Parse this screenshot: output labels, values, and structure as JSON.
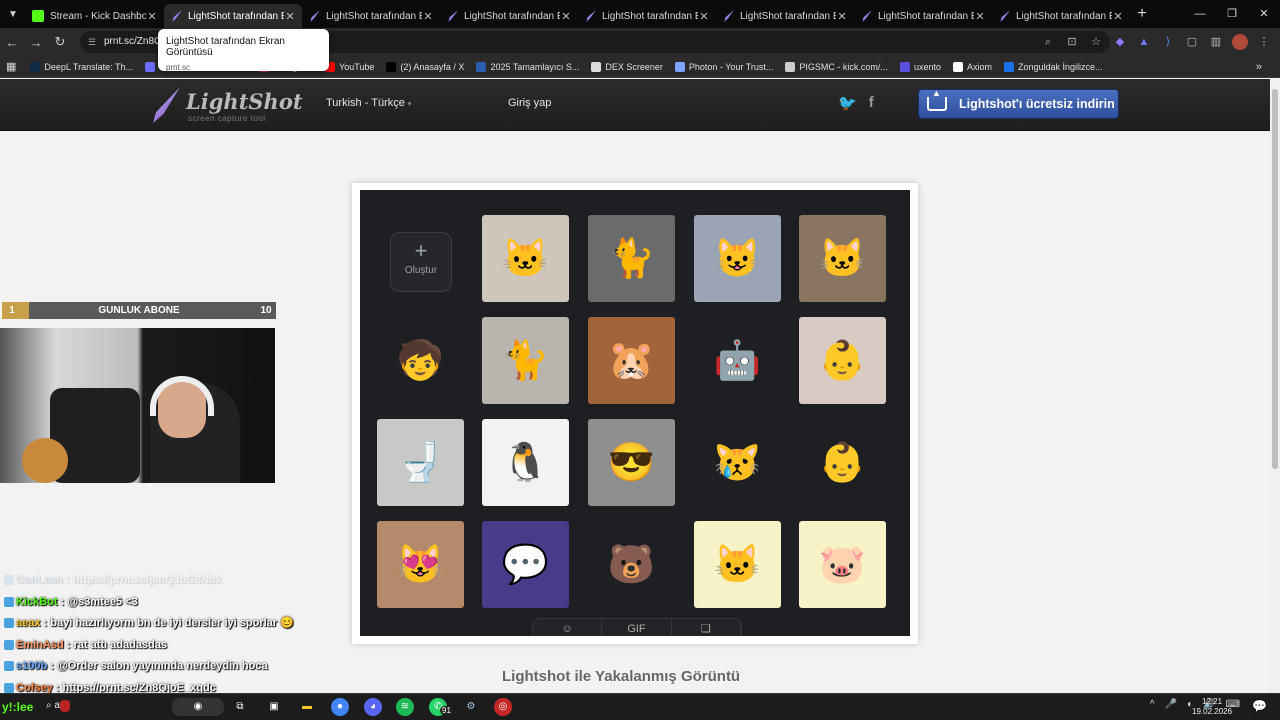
{
  "browser": {
    "tabs": [
      {
        "label": "Stream - Kick Dashboard",
        "icon": "kick-icon",
        "active": false
      },
      {
        "label": "LightShot tarafından Ekra",
        "icon": "lightshot-icon",
        "active": true
      },
      {
        "label": "LightShot tarafından Ekra",
        "icon": "lightshot-icon",
        "active": false
      },
      {
        "label": "LightShot tarafından Ekra",
        "icon": "lightshot-icon",
        "active": false
      },
      {
        "label": "LightShot tarafından Ekra",
        "icon": "lightshot-icon",
        "active": false
      },
      {
        "label": "LightShot tarafından Ekra",
        "icon": "lightshot-icon",
        "active": false
      },
      {
        "label": "LightShot tarafından Ekra",
        "icon": "lightshot-icon",
        "active": false
      },
      {
        "label": "LightShot tarafından Ekra",
        "icon": "lightshot-icon",
        "active": false
      }
    ],
    "tooltip": {
      "title": "LightShot tarafından Ekran Görüntüsü",
      "host": "prnt.sc"
    },
    "url": "prnt.sc/Zn8Q",
    "bookmarks": [
      {
        "label": "DeepL Translate: Th...",
        "color": "#0f2b46"
      },
      {
        "label": "rahmican - Kick Stat...",
        "color": "#6d6dff"
      },
      {
        "label": "Instagram",
        "color": "#e1306c"
      },
      {
        "label": "YouTube",
        "color": "#ff0000"
      },
      {
        "label": "(2) Anasayfa / X",
        "color": "#000000"
      },
      {
        "label": "2025 Tamamlayıcı S...",
        "color": "#2a5db0"
      },
      {
        "label": "DEX Screener",
        "color": "#dddddd"
      },
      {
        "label": "Photon - Your Trust...",
        "color": "#7fa7ff"
      },
      {
        "label": "PIGSMC - kick.com/...",
        "color": "#cccccc"
      },
      {
        "label": "uxento",
        "color": "#5b4fe0"
      },
      {
        "label": "Axiom",
        "color": "#ffffff"
      },
      {
        "label": "Zonguldak İngilizce...",
        "color": "#1a73e8"
      }
    ]
  },
  "lightshot": {
    "logo_name": "LightShot",
    "logo_tagline": "screen capture tool",
    "language": "Turkish - Türkçe",
    "login": "Giriş yap",
    "download_label": "Lightshot'ı ücretsiz indirin",
    "caption": "Lightshot ile Yakalanmış Görüntü",
    "create_label": "Oluştur",
    "bottom_tabs": [
      "☺",
      "GIF",
      "❏"
    ]
  },
  "stickers": [
    {
      "icon": "🐱",
      "bg": "#cfc6bb"
    },
    {
      "icon": "🐈",
      "bg": "#6b6b6b"
    },
    {
      "icon": "😺",
      "bg": "#9aa4b5"
    },
    {
      "icon": "🐱",
      "bg": "#8a7660"
    },
    {
      "icon": "🧒",
      "bg": "#1e1f22"
    },
    {
      "icon": "🐈",
      "bg": "#b9b4ad"
    },
    {
      "icon": "🐹",
      "bg": "#a2653b"
    },
    {
      "icon": "🤖",
      "bg": "#1e1f22"
    },
    {
      "icon": "👶",
      "bg": "#d9cbc4"
    },
    {
      "icon": "🚽",
      "bg": "#c7c9c7"
    },
    {
      "icon": "🐧",
      "bg": "#f2f2f2"
    },
    {
      "icon": "😎",
      "bg": "#8f8f8f"
    },
    {
      "icon": "😿",
      "bg": "#1e1f22"
    },
    {
      "icon": "👶",
      "bg": "#1e1f22"
    },
    {
      "icon": "😻",
      "bg": "#b58a6a"
    },
    {
      "icon": "💬",
      "bg": "#4a3a8a"
    },
    {
      "icon": "🐻",
      "bg": "#1e1f22"
    },
    {
      "icon": "🐱",
      "bg": "#f7f3c6"
    },
    {
      "icon": "🐷",
      "bg": "#f7f3c6"
    }
  ],
  "stream": {
    "sub_goal": {
      "left": "1",
      "label": "GUNLUK ABONE",
      "right": "10",
      "progress": 0.1
    },
    "chat": [
      {
        "user": "ConLean",
        "text": "https://prnt.sc/jsnQ3bG8Nbk",
        "color": "#9ad0ff",
        "faded": true
      },
      {
        "user": "KickBot",
        "text": "@s3mtee5 <3",
        "color": "#53fc18",
        "faded": false
      },
      {
        "user": "aeax",
        "text": "bayi hazırlıyorm bn de iyi dersler iyi sporlar 😊",
        "color": "#ffcc33",
        "faded": false
      },
      {
        "user": "EminAsd",
        "text": "rat attı adadasdas",
        "color": "#ff9966",
        "faded": false
      },
      {
        "user": "s100b",
        "text": "@Order salon yayınında nerdeydin hoca",
        "color": "#66aaff",
        "faded": false
      },
      {
        "user": "Cofsey",
        "text": "https://prnt.sc/Zn8QjoE_xqdc",
        "color": "#ff8844",
        "faded": false
      }
    ]
  },
  "taskbar": {
    "start_text": "y!:lee",
    "search_text": "a",
    "whatsapp_badge": "91",
    "time": "12:21",
    "date": "19.02.2026"
  }
}
